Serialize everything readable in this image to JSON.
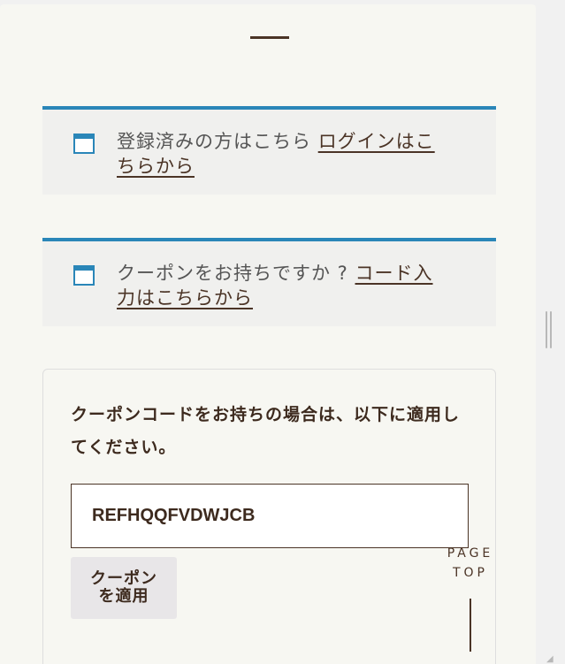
{
  "login_notice": {
    "text": "登録済みの方はこちら ",
    "link": "ログインはこちらから"
  },
  "coupon_notice": {
    "text": "クーポンをお持ちですか ? ",
    "link": "コード入力はこちらから"
  },
  "coupon_form": {
    "description": "クーポンコードをお持ちの場合は、以下に適用してください。",
    "input_value": "REFHQQFVDWJCB",
    "apply_label": "クーポンを適用"
  },
  "page_top": {
    "line1": "PAGE",
    "line2": "TOP"
  },
  "colors": {
    "accent_blue": "#2a86b8",
    "brown": "#4b3426",
    "panel": "#f7f7f2"
  },
  "icons": {
    "notice": "window-icon"
  }
}
